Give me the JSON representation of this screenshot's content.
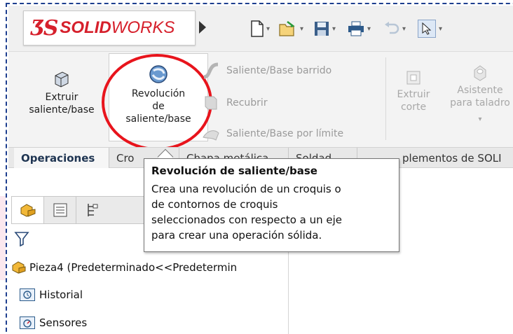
{
  "app": {
    "logo_text_solid": "SOLID",
    "logo_text_works": "WORKS",
    "brand_color": "#d6202c"
  },
  "ribbon": {
    "extruir_saliente": {
      "line1": "Extruir",
      "line2": "saliente/base"
    },
    "revolucion_saliente": {
      "line1": "Revolución",
      "line2": "de",
      "line3": "saliente/base"
    },
    "saliente_barrido": "Saliente/Base barrido",
    "recubrir": "Recubrir",
    "saliente_por_limite": "Saliente/Base por límite",
    "extruir_corte": {
      "line1": "Extruir",
      "line2": "corte"
    },
    "asistente_taladro": {
      "line1": "Asistente",
      "line2": "para taladro"
    }
  },
  "tabs": [
    {
      "label": "Operaciones"
    },
    {
      "label": "Cro"
    },
    {
      "label": "Chapa metálica"
    },
    {
      "label": "Soldad"
    },
    {
      "label": "plementos de SOLI"
    }
  ],
  "tooltip": {
    "title": "Revolución de saliente/base",
    "line1": "Crea una revolución de un croquis o",
    "line2": "de contornos de croquis",
    "line3": "seleccionados con respecto a un eje",
    "line4": "para crear una operación sólida."
  },
  "tree": {
    "part": "Pieza4  (Predeterminado<<Predetermin",
    "historial": "Historial",
    "sensores": "Sensores"
  }
}
